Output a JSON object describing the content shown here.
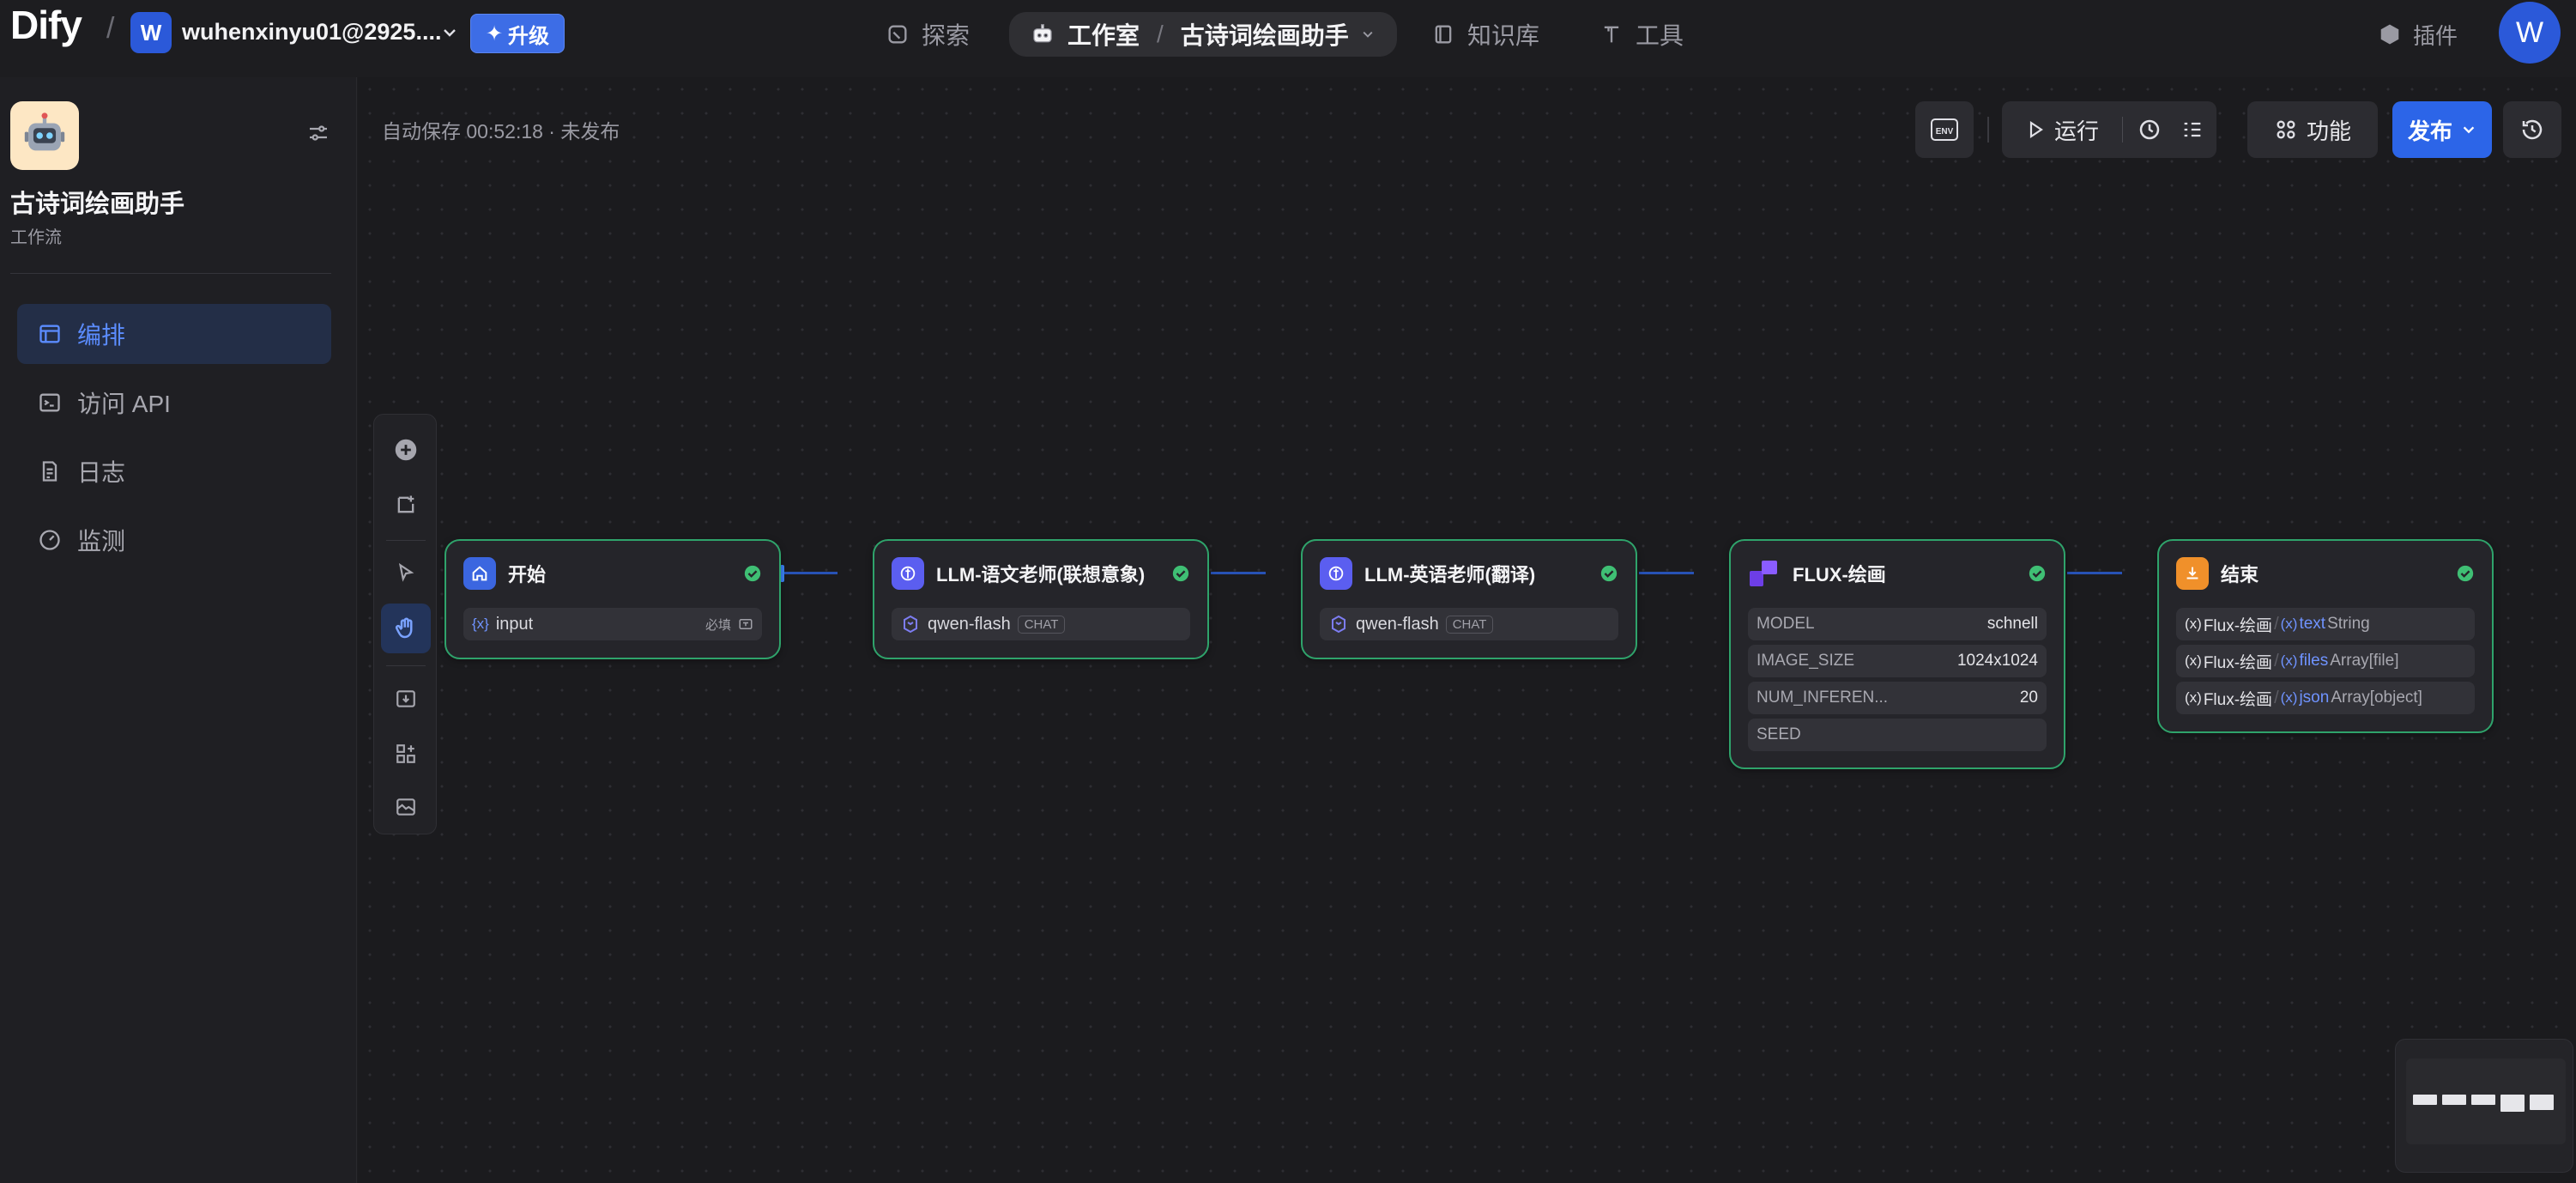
{
  "topbar": {
    "logo": "Dify",
    "workspace_initial": "W",
    "workspace_name": "wuhenxinyu01@2925....",
    "upgrade_label": "升级",
    "nav": {
      "explore": "探索",
      "studio": "工作室",
      "current_app": "古诗词绘画助手",
      "knowledge": "知识库",
      "tools": "工具",
      "plugins": "插件"
    },
    "user_initial": "W"
  },
  "sidebar": {
    "app_name": "古诗词绘画助手",
    "app_type": "工作流",
    "items": [
      {
        "label": "编排",
        "icon": "layout-icon",
        "active": true
      },
      {
        "label": "访问 API",
        "icon": "terminal-icon",
        "active": false
      },
      {
        "label": "日志",
        "icon": "log-file-icon",
        "active": false
      },
      {
        "label": "监测",
        "icon": "gauge-icon",
        "active": false
      }
    ]
  },
  "canvas": {
    "autosave": "自动保存 00:52:18 · 未发布",
    "toolbar": {
      "env_label": "ENV",
      "run_label": "运行",
      "features_label": "功能",
      "publish_label": "发布"
    }
  },
  "nodes": {
    "start": {
      "title": "开始",
      "var_mark": "{x}",
      "var_name": "input",
      "required": "必填"
    },
    "llm_chinese": {
      "title": "LLM-语文老师(联想意象)",
      "model": "qwen-flash",
      "badge": "CHAT"
    },
    "llm_english": {
      "title": "LLM-英语老师(翻译)",
      "model": "qwen-flash",
      "badge": "CHAT"
    },
    "flux": {
      "title": "FLUX-绘画",
      "params": [
        {
          "key": "MODEL",
          "value": "schnell"
        },
        {
          "key": "IMAGE_SIZE",
          "value": "1024x1024"
        },
        {
          "key": "NUM_INFEREN...",
          "value": "20"
        },
        {
          "key": "SEED",
          "value": ""
        }
      ]
    },
    "end": {
      "title": "结束",
      "outputs": [
        {
          "source": "Flux-绘画",
          "var": "text",
          "type": "String"
        },
        {
          "source": "Flux-绘画",
          "var": "files",
          "type": "Array[file]"
        },
        {
          "source": "Flux-绘画",
          "var": "json",
          "type": "Array[object]"
        }
      ],
      "var_mark": "(x)",
      "sep": "/"
    }
  },
  "colors": {
    "accent": "#2c65e8",
    "node_border": "#2fa36b",
    "active_nav": "#5b8cff",
    "status_ok": "#3fbf74"
  }
}
